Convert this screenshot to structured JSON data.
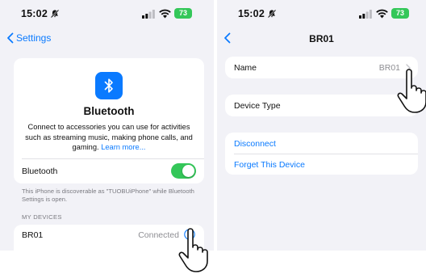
{
  "left_screen": {
    "status_bar": {
      "time": "15:02",
      "battery": "73"
    },
    "nav": {
      "back_label": "Settings"
    },
    "bluetooth_card": {
      "title": "Bluetooth",
      "description": "Connect to accessories you can use for activities such as streaming music, making phone calls, and gaming.",
      "learn_more": "Learn more...",
      "toggle_label": "Bluetooth",
      "toggle_on": true
    },
    "discoverable_note": "This iPhone is discoverable as \"TUOBUiPhone\" while Bluetooth Settings is open.",
    "my_devices_header": "MY DEVICES",
    "device": {
      "name": "BR01",
      "status": "Connected"
    }
  },
  "right_screen": {
    "status_bar": {
      "time": "15:02",
      "battery": "73"
    },
    "nav": {
      "title": "BR01"
    },
    "name_row": {
      "label": "Name",
      "value": "BR01"
    },
    "device_type_row": {
      "label": "Device Type"
    },
    "actions": {
      "disconnect": "Disconnect",
      "forget": "Forget This Device"
    }
  },
  "colors": {
    "accent": "#0a7aff",
    "toggle_on": "#34c759",
    "battery": "#34c759",
    "background": "#f2f2f7"
  },
  "icons": [
    "bluetooth-icon",
    "info-icon",
    "chevron-left-icon",
    "chevron-right-icon",
    "pointing-hand-icon",
    "bell-slash-icon",
    "wifi-icon",
    "cellular-signal-icon",
    "battery-icon"
  ]
}
